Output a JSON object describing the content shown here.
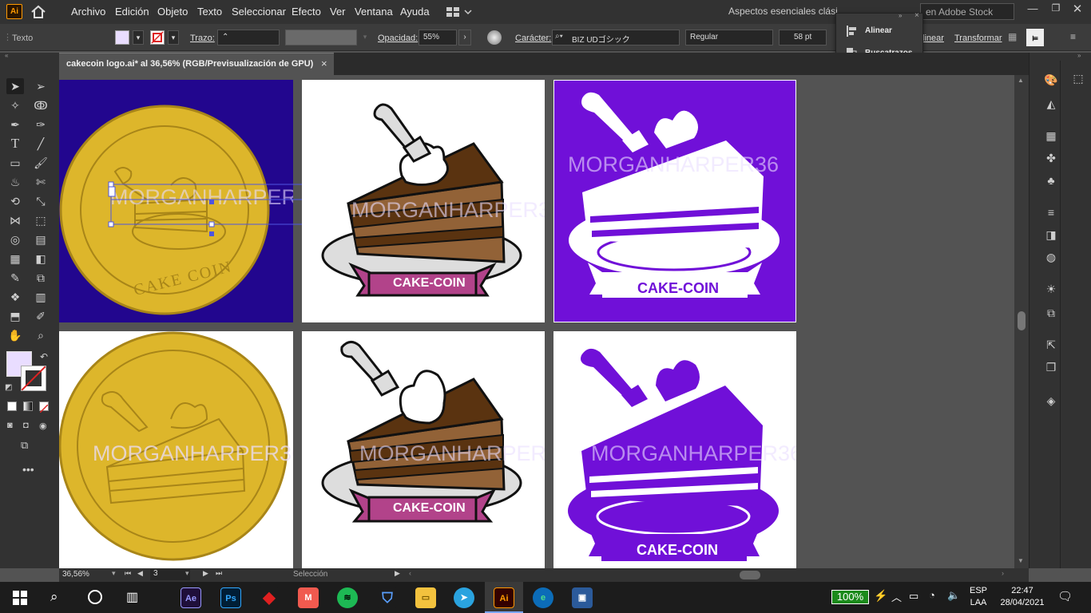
{
  "app": {
    "logo": "Ai",
    "logo_color": "#ff9a00"
  },
  "menu": [
    "Archivo",
    "Edición",
    "Objeto",
    "Texto",
    "Seleccionar",
    "Efecto",
    "Ver",
    "Ventana",
    "Ayuda"
  ],
  "workspace": "Aspectos esenciales clási",
  "stock_search": {
    "placeholder": "en Adobe Stock"
  },
  "control": {
    "mode": "Texto",
    "stroke_label": "Trazo:",
    "opacity_label": "Opacidad:",
    "opacity_value": "55%",
    "char_label": "Carácter:",
    "font": "BIZ UDゴシック",
    "style": "Regular",
    "size": "58 pt",
    "align_link": "linear",
    "transform_link": "Transformar"
  },
  "flyout": {
    "items": [
      "Alinear",
      "Buscatrazos"
    ]
  },
  "document_tab": {
    "title": "cakecoin logo.ai* al 36,56% (RGB/Previsualización de GPU)",
    "close": "×"
  },
  "artboards": {
    "watermark": "MORGANHARPER36",
    "ribbon_text": "CAKE-COIN",
    "coin_text": "CAKE COIN"
  },
  "status": {
    "zoom": "36,56%",
    "artboard": "3",
    "tool": "Selección"
  },
  "taskbar": {
    "battery": "100%",
    "lang1": "ESP",
    "lang2": "LAA",
    "time": "22:47",
    "date": "28/04/2021"
  },
  "colors": {
    "navy": "#22068e",
    "purple": "#7010d8",
    "gold": "#ddb62b",
    "gold_dark": "#a88518",
    "choc_dark": "#5a3310",
    "choc_light": "#926237",
    "ribbon": "#b2438a",
    "selection": "#4d55e0"
  }
}
